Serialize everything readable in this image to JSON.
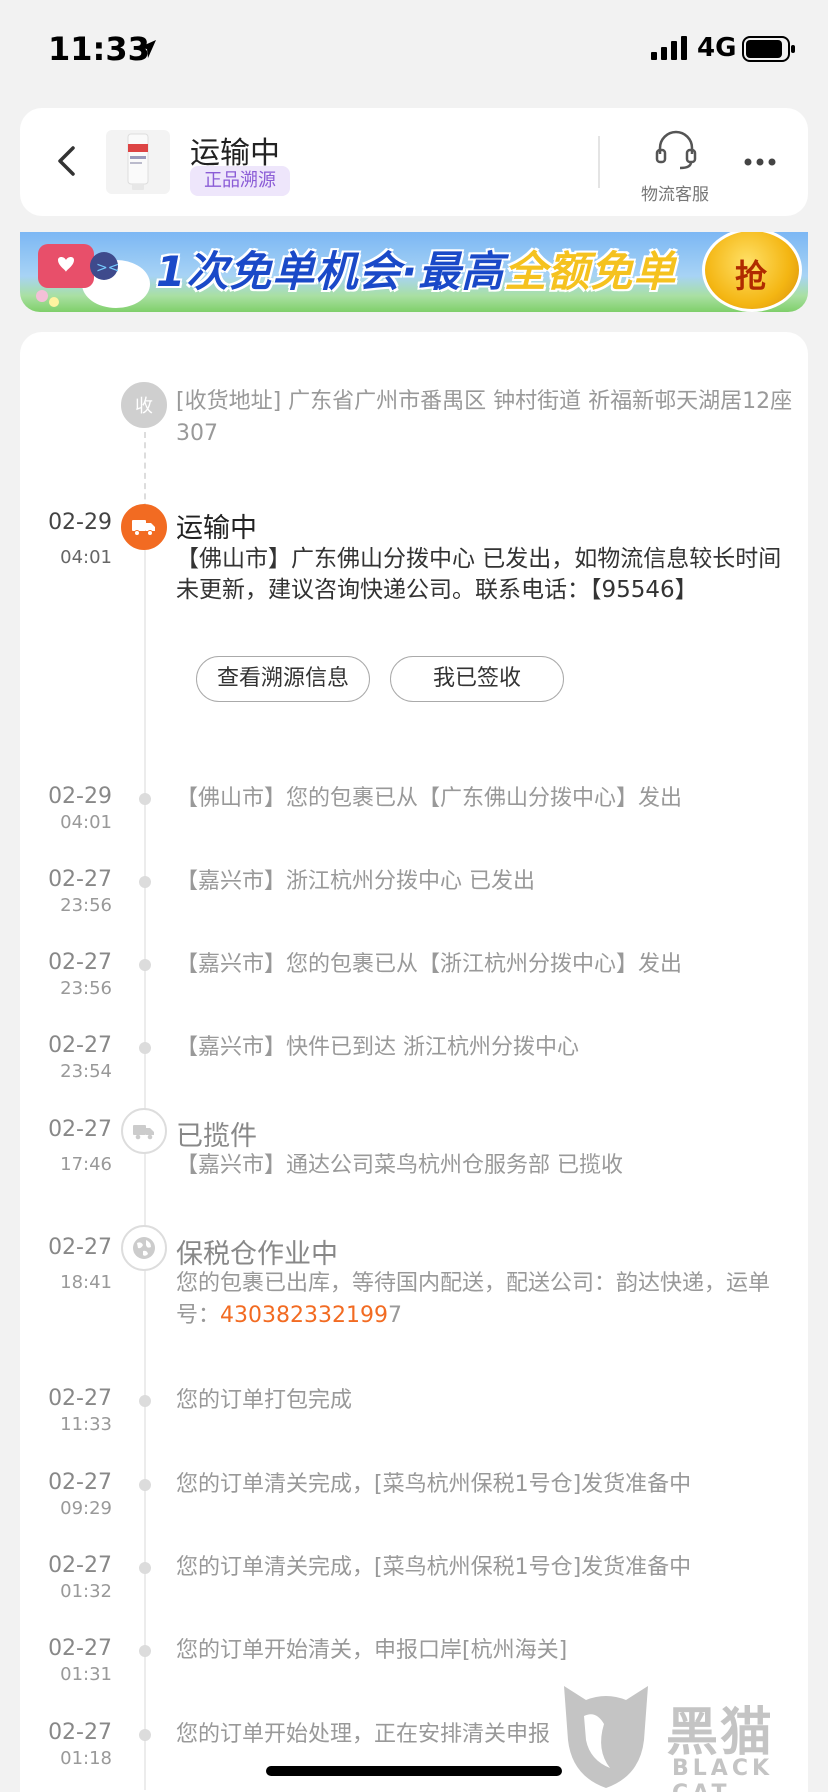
{
  "status_bar": {
    "time": "11:33",
    "network": "4G"
  },
  "header": {
    "title": "运输中",
    "tag": "正品溯源",
    "customer_service_label": "物流客服"
  },
  "banner": {
    "text_main": "1次免单机会·最高",
    "text_highlight": "全额免单",
    "grab_label": "抢"
  },
  "address": {
    "node_label": "收",
    "text": "[收货地址] 广东省广州市番禺区  钟村街道   祈福新邨天湖居12座307"
  },
  "current": {
    "date": "02-29",
    "time": "04:01",
    "title": "运输中",
    "text": "【佛山市】广东佛山分拨中心 已发出，如物流信息较长时间未更新，建议咨询快递公司。联系电话：【95546】",
    "buttons": [
      "查看溯源信息",
      "我已签收"
    ]
  },
  "events": [
    {
      "date": "02-29",
      "time": "04:01",
      "text": "【佛山市】您的包裹已从【广东佛山分拨中心】发出"
    },
    {
      "date": "02-27",
      "time": "23:56",
      "text": "【嘉兴市】浙江杭州分拨中心 已发出"
    },
    {
      "date": "02-27",
      "time": "23:56",
      "text": "【嘉兴市】您的包裹已从【浙江杭州分拨中心】发出"
    },
    {
      "date": "02-27",
      "time": "23:54",
      "text": "【嘉兴市】快件已到达 浙江杭州分拨中心"
    }
  ],
  "pickup": {
    "date": "02-27",
    "time": "17:46",
    "title": "已揽件",
    "text": "【嘉兴市】通达公司菜鸟杭州仓服务部 已揽收"
  },
  "warehouse": {
    "date": "02-27",
    "time": "18:41",
    "title": "保税仓作业中",
    "text_prefix": "您的包裹已出库，等待国内配送，配送公司：韵达快递，运单号：",
    "tracking_highlight": "430382332199",
    "tracking_tail": "7"
  },
  "events2": [
    {
      "date": "02-27",
      "time": "11:33",
      "text": "您的订单打包完成"
    },
    {
      "date": "02-27",
      "time": "09:29",
      "text": "您的订单清关完成，[菜鸟杭州保税1号仓]发货准备中"
    },
    {
      "date": "02-27",
      "time": "01:32",
      "text": "您的订单清关完成，[菜鸟杭州保税1号仓]发货准备中"
    },
    {
      "date": "02-27",
      "time": "01:31",
      "text": "您的订单开始清关，申报口岸[杭州海关]"
    },
    {
      "date": "02-27",
      "time": "01:18",
      "text": "您的订单开始处理，正在安排清关申报"
    }
  ],
  "watermark": {
    "cn": "黑猫",
    "en": "BLACK CAT"
  },
  "colors": {
    "accent": "#f26b22",
    "tag_purple": "#8b5cd6"
  }
}
